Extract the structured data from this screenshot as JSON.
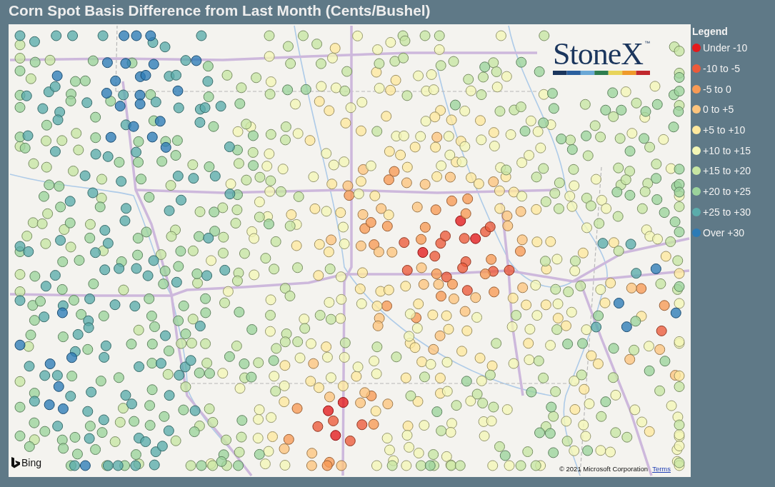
{
  "title": "Corn Spot Basis Difference from Last Month (Cents/Bushel)",
  "map": {
    "logo": {
      "text": "StoneX",
      "trademark": "™"
    },
    "provider": {
      "name": "Bing"
    },
    "copyright": "© 2021 Microsoft Corporation",
    "terms_link": "Terms"
  },
  "legend": {
    "title": "Legend",
    "items": [
      {
        "label": "Under -10",
        "color": "#e31a1c"
      },
      {
        "label": "-10 to -5",
        "color": "#ec5a3a"
      },
      {
        "label": "-5 to 0",
        "color": "#f79a55"
      },
      {
        "label": "0 to +5",
        "color": "#fdc47d"
      },
      {
        "label": "+5 to +10",
        "color": "#fee89e"
      },
      {
        "label": "+10 to +15",
        "color": "#f3f6b6"
      },
      {
        "label": "+15 to +20",
        "color": "#c7e6a3"
      },
      {
        "label": "+20 to +25",
        "color": "#9bd39b"
      },
      {
        "label": "+25 to +30",
        "color": "#5aacab"
      },
      {
        "label": "Over +30",
        "color": "#2c7bb6"
      }
    ]
  }
}
